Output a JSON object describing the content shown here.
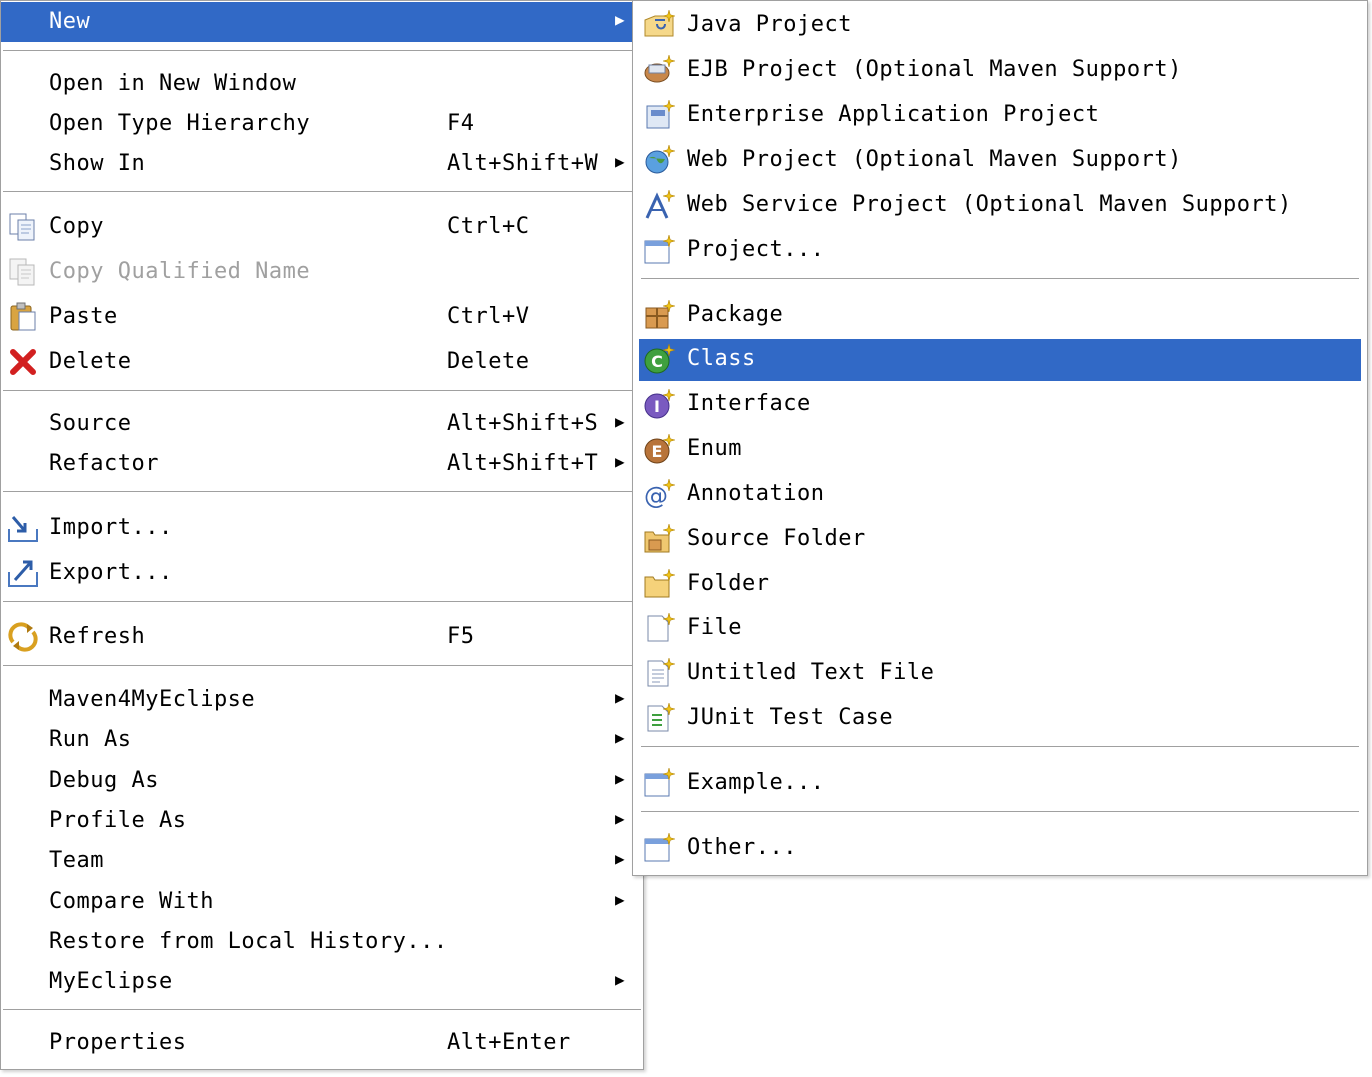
{
  "main_menu": {
    "new": "New",
    "open_new_window": "Open in New Window",
    "open_type_hierarchy": "Open Type Hierarchy",
    "open_type_hierarchy_key": "F4",
    "show_in": "Show In",
    "show_in_key": "Alt+Shift+W",
    "copy": "Copy",
    "copy_key": "Ctrl+C",
    "copy_qualified_name": "Copy Qualified Name",
    "paste": "Paste",
    "paste_key": "Ctrl+V",
    "delete": "Delete",
    "delete_key": "Delete",
    "source": "Source",
    "source_key": "Alt+Shift+S",
    "refactor": "Refactor",
    "refactor_key": "Alt+Shift+T",
    "import": "Import...",
    "export": "Export...",
    "refresh": "Refresh",
    "refresh_key": "F5",
    "maven": "Maven4MyEclipse",
    "run_as": "Run As",
    "debug_as": "Debug As",
    "profile_as": "Profile As",
    "team": "Team",
    "compare_with": "Compare With",
    "restore_history": "Restore from Local History...",
    "myeclipse": "MyEclipse",
    "properties": "Properties",
    "properties_key": "Alt+Enter"
  },
  "sub_menu": {
    "java_project": "Java Project",
    "ejb_project": "EJB Project (Optional Maven Support)",
    "enterprise_app": "Enterprise Application Project",
    "web_project": "Web Project (Optional Maven Support)",
    "web_service_project": "Web Service Project (Optional Maven Support)",
    "project": "Project...",
    "package": "Package",
    "class": "Class",
    "interface": "Interface",
    "enum": "Enum",
    "annotation": "Annotation",
    "source_folder": "Source Folder",
    "folder": "Folder",
    "file": "File",
    "untitled_text": "Untitled Text File",
    "junit": "JUnit Test Case",
    "example": "Example...",
    "other": "Other..."
  },
  "colors": {
    "selection": "#3169c6",
    "disabled_text": "#a0a0a0",
    "separator": "#a0a0a0"
  }
}
